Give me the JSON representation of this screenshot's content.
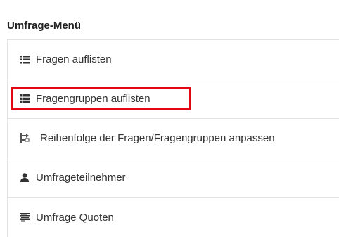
{
  "panel": {
    "title": "Umfrage-Menü"
  },
  "menu": {
    "items": [
      {
        "label": "Fragen auflisten",
        "icon": "list-icon"
      },
      {
        "label": "Fragengruppen auflisten",
        "icon": "list-thick-icon",
        "highlighted": true
      },
      {
        "label": "Reihenfolge der Fragen/Fragengruppen anpassen",
        "icon": "reorder-icon"
      },
      {
        "label": "Umfrageteilnehmer",
        "icon": "user-icon"
      },
      {
        "label": "Umfrage Quoten",
        "icon": "tasks-icon"
      }
    ]
  },
  "colors": {
    "highlight": "#e30613",
    "text": "#333333",
    "border": "#e2e2e2"
  }
}
